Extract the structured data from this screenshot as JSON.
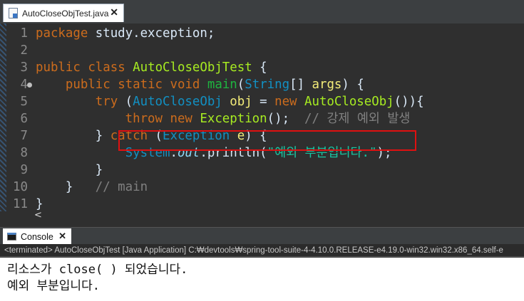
{
  "editor_tab": {
    "label": "AutoCloseObjTest.java",
    "close": "✕"
  },
  "code_lines": [
    {
      "num": "1",
      "html": "<span class=\"kw\">package</span> study.exception;"
    },
    {
      "num": "2",
      "html": ""
    },
    {
      "num": "3",
      "html": "<span class=\"kw\">public</span> <span class=\"kw\">class</span> <span class=\"cl\">AutoCloseObjTest</span> {"
    },
    {
      "num": "4",
      "html": "    <span class=\"kw\">public</span> <span class=\"kw\">static</span> <span class=\"kw\">void</span> <span class=\"fn\">main</span>(<span class=\"ty\">String</span>[] <span class=\"var\">args</span>) {",
      "fold": true
    },
    {
      "num": "5",
      "html": "        <span class=\"kw\">try</span> (<span class=\"ty\">AutoCloseObj</span> <span class=\"var\">obj</span> = <span class=\"kw\">new</span> <span class=\"cl\">AutoCloseObj</span>()){"
    },
    {
      "num": "6",
      "html": "            <span class=\"kw\">throw</span> <span class=\"kw\">new</span> <span class=\"cl\">Exception</span>();  <span class=\"cmt\">// 강제 예외 발생</span>"
    },
    {
      "num": "7",
      "html": "        } <span class=\"kw\">catch</span> (<span class=\"ty\">Exception</span> <span class=\"var\">e</span>) {"
    },
    {
      "num": "8",
      "html": "            <span class=\"ty\">System</span>.<span class=\"fld\">out</span>.println(<span class=\"str\">\"예외 부분입니다.\"</span>);"
    },
    {
      "num": "9",
      "html": "        }"
    },
    {
      "num": "10",
      "html": "    }   <span class=\"cmt\">// main</span>"
    },
    {
      "num": "11",
      "html": "}"
    }
  ],
  "hscroll_arrow": "<",
  "console_tab": {
    "label": "Console",
    "close": "✕"
  },
  "console_status": "<terminated> AutoCloseObjTest [Java Application] C:₩devtools₩spring-tool-suite-4-4.10.0.RELEASE-e4.19.0-win32.win32.x86_64.self-e",
  "console_output": [
    "리소스가 close( ) 되었습니다.",
    "예외 부분입니다."
  ],
  "colors": {
    "keyword": "#cc6c1d",
    "type": "#1290c3",
    "class_name": "#a7ec21",
    "method": "#1eb540",
    "variable": "#f3ec79",
    "string": "#17c6a3",
    "comment": "#808080",
    "highlight_box": "#e01010"
  }
}
